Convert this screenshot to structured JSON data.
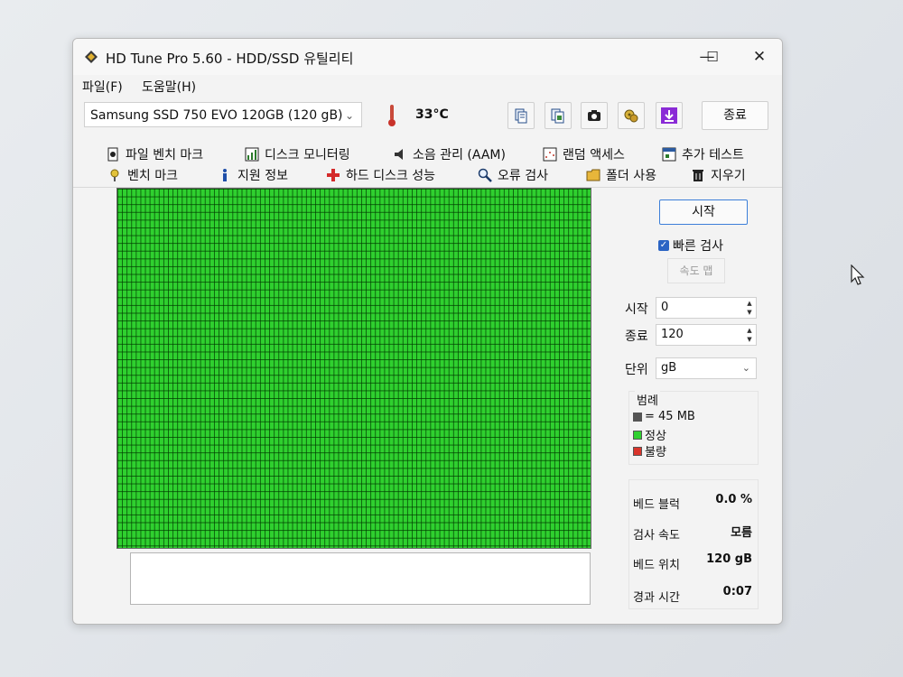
{
  "window": {
    "title": "HD Tune Pro 5.60 - HDD/SSD 유틸리티",
    "controls": {
      "minimize": "—",
      "maximize": "☐",
      "close": "✕"
    }
  },
  "menu": {
    "file": "파일(F)",
    "help": "도움말(H)"
  },
  "toolbar": {
    "drive": "Samsung SSD 750 EVO 120GB (120 gB)",
    "temperature": "33°C",
    "exit": "종료",
    "icons": [
      "copy-text-icon",
      "copy-info-icon",
      "screenshot-camera-icon",
      "options-gear-icon",
      "save-download-icon"
    ]
  },
  "tabs": {
    "row1": [
      "파일 벤치 마크",
      "디스크 모니터링",
      "소음 관리 (AAM)",
      "랜덤 액세스",
      "추가 테스트"
    ],
    "row2": [
      "벤치 마크",
      "지원 정보",
      "하드 디스크 성능",
      "오류 검사",
      "폴더 사용",
      "지우기"
    ],
    "active": "오류 검사"
  },
  "scan": {
    "start_button": "시작",
    "quick_scan_label": "빠른 검사",
    "quick_scan_checked": true,
    "speed_map_button": "속도 맵",
    "start_label": "시작",
    "start_value": "0",
    "end_label": "종료",
    "end_value": "120",
    "unit_label": "단위",
    "unit_value": "gB",
    "block_status": "all-healthy"
  },
  "legend": {
    "title": "범례",
    "block_size": "= 45 MB",
    "ok": "정상",
    "bad": "불량",
    "colors": {
      "block": "#555555",
      "ok": "#2fd02f",
      "bad": "#d9342b"
    }
  },
  "stats": {
    "bad_blocks_label": "베드 블럭",
    "bad_blocks_value": "0.0 %",
    "scan_speed_label": "검사 속도",
    "scan_speed_value": "모름",
    "bad_position_label": "베드 위치",
    "bad_position_value": "120 gB",
    "elapsed_label": "경과 시간",
    "elapsed_value": "0:07"
  }
}
